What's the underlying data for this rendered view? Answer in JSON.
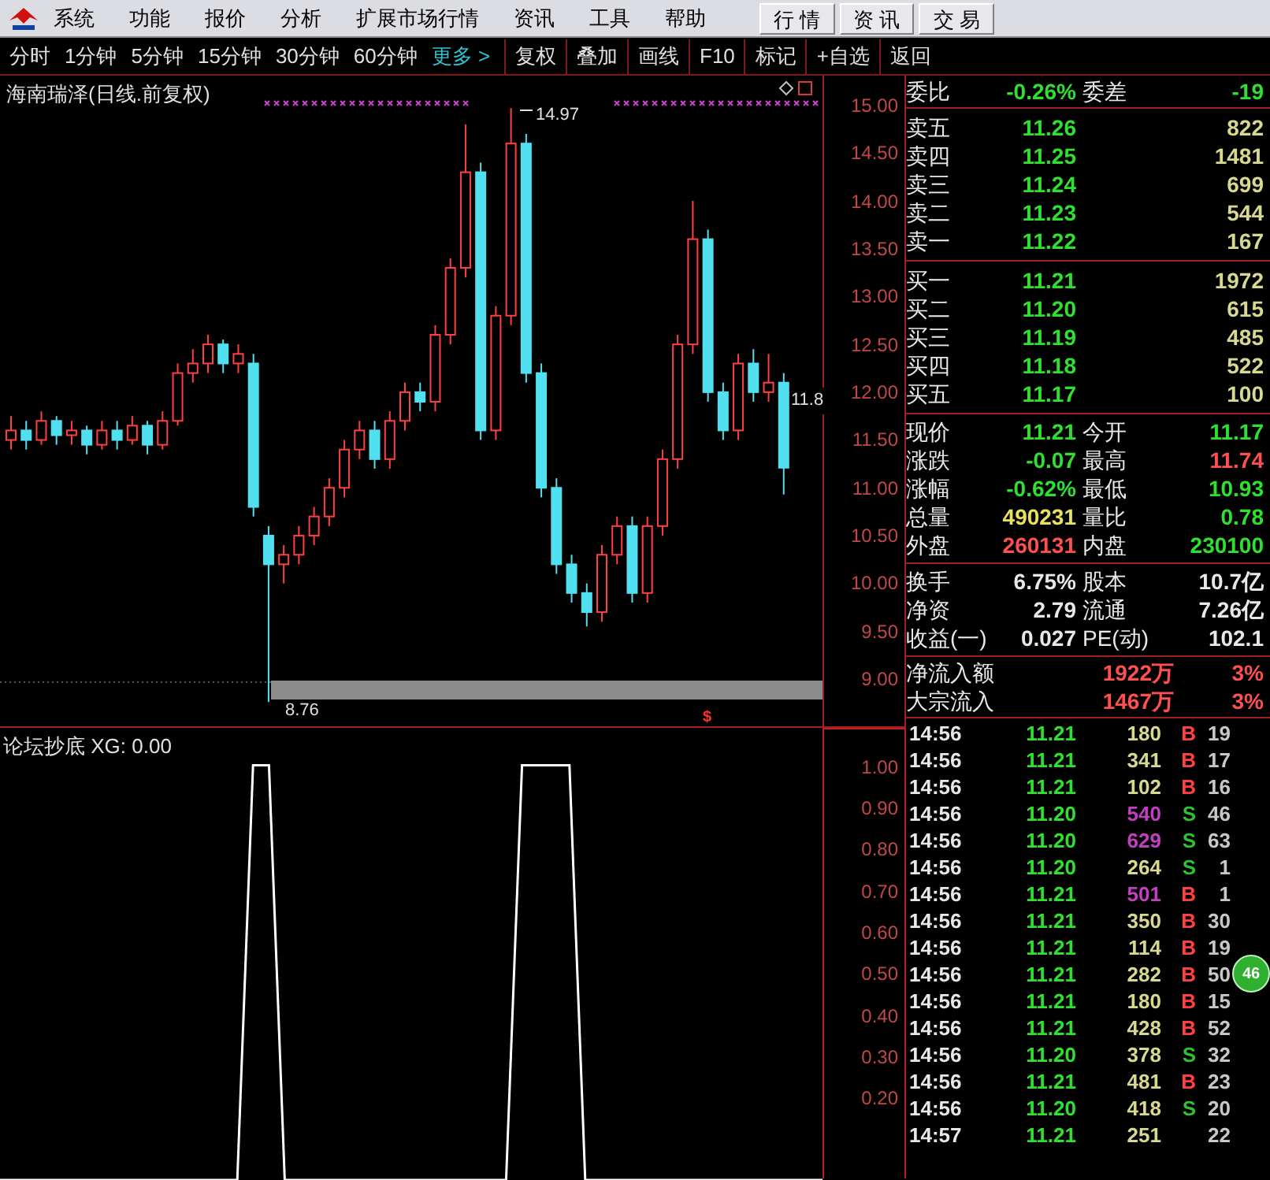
{
  "menu": [
    "系统",
    "功能",
    "报价",
    "分析",
    "扩展市场行情",
    "资讯",
    "工具",
    "帮助"
  ],
  "top_tabs": [
    {
      "label": "行 情",
      "selected": false
    },
    {
      "label": "资 讯",
      "selected": false
    },
    {
      "label": "交 易",
      "selected": false
    }
  ],
  "periods": [
    {
      "label": "分时",
      "kind": "period"
    },
    {
      "label": "1分钟",
      "kind": "period"
    },
    {
      "label": "5分钟",
      "kind": "period"
    },
    {
      "label": "15分钟",
      "kind": "period"
    },
    {
      "label": "30分钟",
      "kind": "period"
    },
    {
      "label": "60分钟",
      "kind": "period"
    },
    {
      "label": "更多 >",
      "kind": "more"
    }
  ],
  "tools": [
    "复权",
    "叠加",
    "画线",
    "F10",
    "标记",
    "+自选",
    "返回"
  ],
  "chart": {
    "title": "海南瑞泽(日线.前复权)",
    "high_label": "14.97",
    "low_label": "8.76",
    "last_label": "11.8",
    "marker": "$",
    "chart_data": {
      "type": "candlestick",
      "ylim": [
        8.49,
        15.31
      ],
      "yticks": [
        {
          "value": 15,
          "label": "15.00"
        },
        {
          "value": 14.5,
          "label": "14.50"
        },
        {
          "value": 14,
          "label": "14.00"
        },
        {
          "value": 13.5,
          "label": "13.50"
        },
        {
          "value": 13,
          "label": "13.00"
        },
        {
          "value": 12.5,
          "label": "12.50"
        },
        {
          "value": 12,
          "label": "12.00"
        },
        {
          "value": 11.5,
          "label": "11.50"
        },
        {
          "value": 11,
          "label": "11.00"
        },
        {
          "value": 10.5,
          "label": "10.50"
        },
        {
          "value": 10,
          "label": "10.00"
        },
        {
          "value": 9.5,
          "label": "9.50"
        },
        {
          "value": 9,
          "label": "9.00"
        }
      ],
      "ohlc": [
        [
          11.5,
          11.75,
          11.4,
          11.6
        ],
        [
          11.6,
          11.7,
          11.4,
          11.5
        ],
        [
          11.5,
          11.8,
          11.45,
          11.7
        ],
        [
          11.7,
          11.75,
          11.45,
          11.55
        ],
        [
          11.55,
          11.7,
          11.45,
          11.6
        ],
        [
          11.6,
          11.65,
          11.35,
          11.45
        ],
        [
          11.45,
          11.7,
          11.4,
          11.6
        ],
        [
          11.6,
          11.7,
          11.4,
          11.5
        ],
        [
          11.5,
          11.75,
          11.45,
          11.65
        ],
        [
          11.65,
          11.7,
          11.35,
          11.45
        ],
        [
          11.45,
          11.8,
          11.4,
          11.7
        ],
        [
          11.7,
          12.3,
          11.65,
          12.2
        ],
        [
          12.2,
          12.45,
          12.1,
          12.3
        ],
        [
          12.3,
          12.6,
          12.2,
          12.5
        ],
        [
          12.5,
          12.55,
          12.2,
          12.3
        ],
        [
          12.3,
          12.5,
          12.2,
          12.4
        ],
        [
          12.3,
          12.4,
          10.7,
          10.8
        ],
        [
          10.5,
          10.6,
          8.76,
          10.2
        ],
        [
          10.2,
          10.4,
          10.0,
          10.3
        ],
        [
          10.3,
          10.6,
          10.2,
          10.5
        ],
        [
          10.5,
          10.8,
          10.4,
          10.7
        ],
        [
          10.7,
          11.1,
          10.6,
          11.0
        ],
        [
          11.0,
          11.5,
          10.9,
          11.4
        ],
        [
          11.4,
          11.7,
          11.3,
          11.6
        ],
        [
          11.6,
          11.7,
          11.2,
          11.3
        ],
        [
          11.3,
          11.8,
          11.2,
          11.7
        ],
        [
          11.7,
          12.1,
          11.6,
          12.0
        ],
        [
          12.0,
          12.1,
          11.8,
          11.9
        ],
        [
          11.9,
          12.7,
          11.8,
          12.6
        ],
        [
          12.6,
          13.4,
          12.5,
          13.3
        ],
        [
          13.3,
          14.8,
          13.2,
          14.3
        ],
        [
          14.3,
          14.4,
          11.5,
          11.6
        ],
        [
          11.6,
          12.9,
          11.5,
          12.8
        ],
        [
          12.8,
          14.97,
          12.7,
          14.6
        ],
        [
          14.6,
          14.7,
          12.1,
          12.2
        ],
        [
          12.2,
          12.3,
          10.9,
          11.0
        ],
        [
          11.0,
          11.1,
          10.1,
          10.2
        ],
        [
          10.2,
          10.3,
          9.8,
          9.9
        ],
        [
          9.9,
          10.0,
          9.55,
          9.7
        ],
        [
          9.7,
          10.4,
          9.6,
          10.3
        ],
        [
          10.3,
          10.7,
          10.2,
          10.6
        ],
        [
          10.6,
          10.7,
          9.8,
          9.9
        ],
        [
          9.9,
          10.7,
          9.8,
          10.6
        ],
        [
          10.6,
          11.4,
          10.5,
          11.3
        ],
        [
          11.3,
          12.6,
          11.2,
          12.5
        ],
        [
          12.5,
          14.0,
          12.4,
          13.6
        ],
        [
          13.6,
          13.7,
          11.9,
          12.0
        ],
        [
          12.0,
          12.1,
          11.5,
          11.6
        ],
        [
          11.6,
          12.4,
          11.5,
          12.3
        ],
        [
          12.3,
          12.45,
          11.9,
          12.0
        ],
        [
          12.0,
          12.4,
          11.9,
          12.1
        ],
        [
          12.1,
          12.2,
          10.93,
          11.21
        ]
      ]
    }
  },
  "indicator": {
    "title": "论坛抄底 XG: 0.00",
    "chart_data": {
      "type": "line",
      "ylim": [
        0,
        1.09
      ],
      "yticks": [
        {
          "value": 1,
          "label": "1.00"
        },
        {
          "value": 0.9,
          "label": "0.90"
        },
        {
          "value": 0.8,
          "label": "0.80"
        },
        {
          "value": 0.7,
          "label": "0.70"
        },
        {
          "value": 0.6,
          "label": "0.60"
        },
        {
          "value": 0.5,
          "label": "0.50"
        },
        {
          "value": 0.4,
          "label": "0.40"
        },
        {
          "value": 0.3,
          "label": "0.30"
        },
        {
          "value": 0.2,
          "label": "0.20"
        }
      ],
      "series": [
        {
          "color": "#ffffff",
          "values": [
            0,
            0,
            0,
            0,
            0,
            0,
            0,
            0,
            0,
            0,
            0,
            0,
            0,
            0,
            0,
            0,
            1,
            1,
            0,
            0,
            0,
            0,
            0,
            0,
            0,
            0,
            0,
            0,
            0,
            0,
            0,
            0,
            0,
            1,
            1,
            1,
            1,
            0,
            0,
            0,
            0,
            0,
            0,
            0,
            0,
            0,
            0,
            0,
            0,
            0,
            0,
            0,
            0
          ]
        }
      ]
    }
  },
  "order_ratio": {
    "label": "委比",
    "value": "-0.26%",
    "label2": "委差",
    "value2": "-19"
  },
  "asks": [
    {
      "label": "卖五",
      "price": "11.26",
      "volume": "822"
    },
    {
      "label": "卖四",
      "price": "11.25",
      "volume": "1481"
    },
    {
      "label": "卖三",
      "price": "11.24",
      "volume": "699"
    },
    {
      "label": "卖二",
      "price": "11.23",
      "volume": "544"
    },
    {
      "label": "卖一",
      "price": "11.22",
      "volume": "167"
    }
  ],
  "bids": [
    {
      "label": "买一",
      "price": "11.21",
      "volume": "1972"
    },
    {
      "label": "买二",
      "price": "11.20",
      "volume": "615"
    },
    {
      "label": "买三",
      "price": "11.19",
      "volume": "485"
    },
    {
      "label": "买四",
      "price": "11.18",
      "volume": "522"
    },
    {
      "label": "买五",
      "price": "11.17",
      "volume": "100"
    }
  ],
  "quote": [
    {
      "label": "现价",
      "value": "11.21",
      "color": "#30e030"
    },
    {
      "label": "今开",
      "value": "11.17",
      "color": "#30e030"
    },
    {
      "label": "涨跌",
      "value": "-0.07",
      "color": "#30e030"
    },
    {
      "label": "最高",
      "value": "11.74",
      "color": "#ff5050"
    },
    {
      "label": "涨幅",
      "value": "-0.62%",
      "color": "#30e030"
    },
    {
      "label": "最低",
      "value": "10.93",
      "color": "#30e030"
    },
    {
      "label": "总量",
      "value": "490231",
      "color": "#e8e060"
    },
    {
      "label": "量比",
      "value": "0.78",
      "color": "#30e030"
    },
    {
      "label": "外盘",
      "value": "260131",
      "color": "#ff5050"
    },
    {
      "label": "内盘",
      "value": "230100",
      "color": "#30e030"
    }
  ],
  "stats": [
    {
      "label": "换手",
      "value": "6.75%",
      "label2": "股本",
      "value2": "10.7亿"
    },
    {
      "label": "净资",
      "value": "2.79",
      "label2": "流通",
      "value2": "7.26亿"
    },
    {
      "label": "收益(一)",
      "value": "0.027",
      "label2": "PE(动)",
      "value2": "102.1"
    }
  ],
  "flows": [
    {
      "label": "净流入额",
      "value": "1922万",
      "pct": "3%"
    },
    {
      "label": "大宗流入",
      "value": "1467万",
      "pct": "3%"
    }
  ],
  "trades": [
    {
      "time": "14:56",
      "price": "11.21",
      "volume": "180",
      "large": false,
      "side": "B",
      "kind": "buy",
      "count": "19"
    },
    {
      "time": "14:56",
      "price": "11.21",
      "volume": "341",
      "large": false,
      "side": "B",
      "kind": "buy",
      "count": "17"
    },
    {
      "time": "14:56",
      "price": "11.21",
      "volume": "102",
      "large": false,
      "side": "B",
      "kind": "buy",
      "count": "16"
    },
    {
      "time": "14:56",
      "price": "11.20",
      "volume": "540",
      "large": true,
      "side": "S",
      "kind": "sell",
      "count": "46"
    },
    {
      "time": "14:56",
      "price": "11.20",
      "volume": "629",
      "large": true,
      "side": "S",
      "kind": "sell",
      "count": "63"
    },
    {
      "time": "14:56",
      "price": "11.20",
      "volume": "264",
      "large": false,
      "side": "S",
      "kind": "sell",
      "count": "1"
    },
    {
      "time": "14:56",
      "price": "11.21",
      "volume": "501",
      "large": true,
      "side": "B",
      "kind": "buy",
      "count": "1"
    },
    {
      "time": "14:56",
      "price": "11.21",
      "volume": "350",
      "large": false,
      "side": "B",
      "kind": "buy",
      "count": "30"
    },
    {
      "time": "14:56",
      "price": "11.21",
      "volume": "114",
      "large": false,
      "side": "B",
      "kind": "buy",
      "count": "19"
    },
    {
      "time": "14:56",
      "price": "11.21",
      "volume": "282",
      "large": false,
      "side": "B",
      "kind": "buy",
      "count": "50"
    },
    {
      "time": "14:56",
      "price": "11.21",
      "volume": "180",
      "large": false,
      "side": "B",
      "kind": "buy",
      "count": "15"
    },
    {
      "time": "14:56",
      "price": "11.21",
      "volume": "428",
      "large": false,
      "side": "B",
      "kind": "buy",
      "count": "52"
    },
    {
      "time": "14:56",
      "price": "11.20",
      "volume": "378",
      "large": false,
      "side": "S",
      "kind": "sell",
      "count": "32"
    },
    {
      "time": "14:56",
      "price": "11.21",
      "volume": "481",
      "large": false,
      "side": "B",
      "kind": "buy",
      "count": "23"
    },
    {
      "time": "14:56",
      "price": "11.20",
      "volume": "418",
      "large": false,
      "side": "S",
      "kind": "sell",
      "count": "20"
    },
    {
      "time": "14:57",
      "price": "11.21",
      "volume": "251",
      "large": false,
      "kind": "buy",
      "count": "22"
    }
  ],
  "float_badge": "46"
}
